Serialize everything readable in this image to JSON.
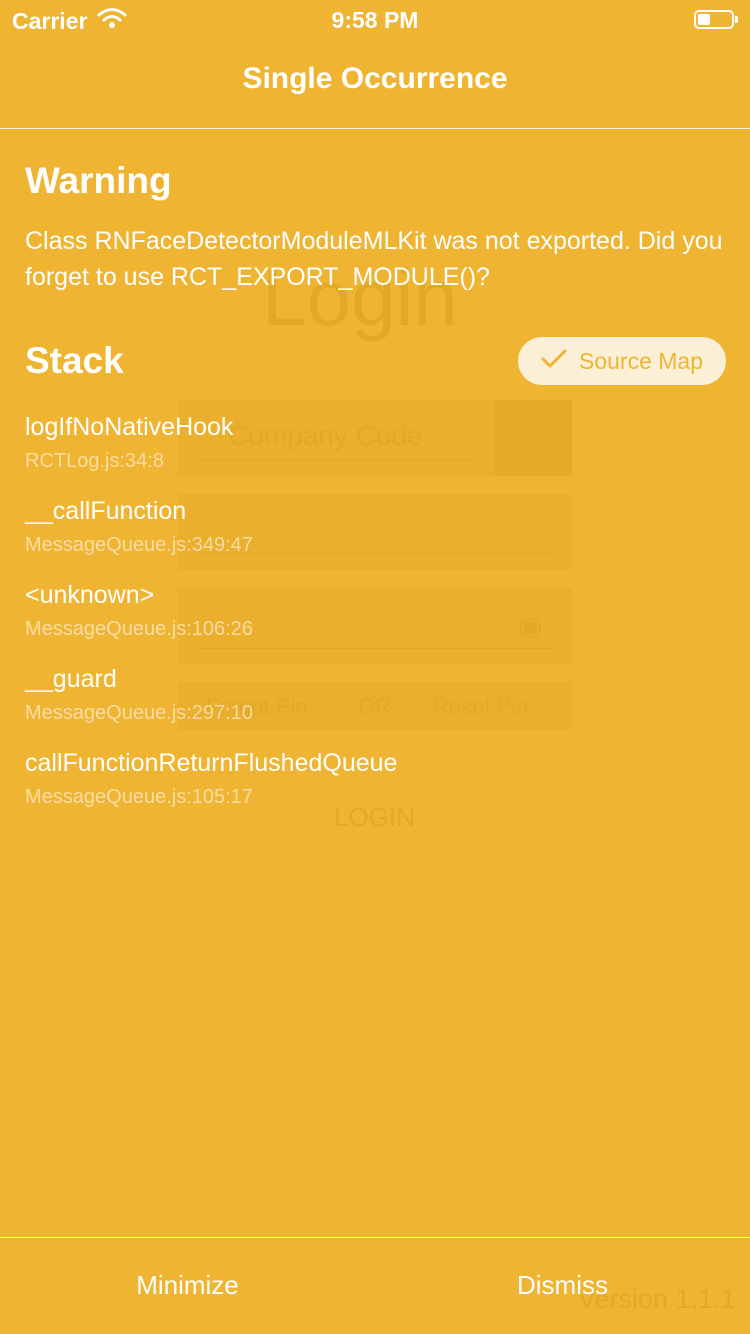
{
  "status_bar": {
    "carrier": "Carrier",
    "time": "9:58 PM"
  },
  "nav": {
    "title": "Single Occurrence"
  },
  "warning": {
    "title": "Warning",
    "message": "Class RNFaceDetectorModuleMLKit was not exported. Did you forget to use RCT_EXPORT_MODULE()?"
  },
  "stack": {
    "title": "Stack",
    "source_map_label": "Source Map",
    "frames": [
      {
        "method": "logIfNoNativeHook",
        "location": "RCTLog.js:34:8"
      },
      {
        "method": "__callFunction",
        "location": "MessageQueue.js:349:47"
      },
      {
        "method": "<unknown>",
        "location": "MessageQueue.js:106:26"
      },
      {
        "method": "__guard",
        "location": "MessageQueue.js:297:10"
      },
      {
        "method": "callFunctionReturnFlushedQueue",
        "location": "MessageQueue.js:105:17"
      }
    ]
  },
  "actions": {
    "minimize_label": "Minimize",
    "dismiss_label": "Dismiss"
  },
  "background_app": {
    "heading": "Login",
    "company_code_placeholder": "Company Code",
    "forgot_pin": "Forgot Pin",
    "or": "OR",
    "reset_pin": "Reset Pin",
    "login_button": "LOGIN",
    "version": "Version 1.1.1"
  },
  "colors": {
    "overlay_background": "#efb431",
    "source_map_pill": "#fbf0d6",
    "text": "#ffffff"
  },
  "icons": {
    "wifi": "wifi-icon",
    "battery": "battery-icon",
    "checkmark": "checkmark-icon",
    "pencil": "pencil-icon",
    "eye": "eye-icon"
  }
}
